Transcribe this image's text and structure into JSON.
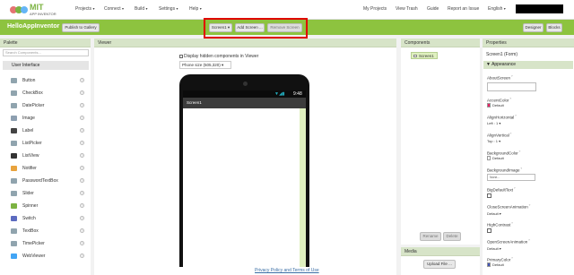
{
  "brand": {
    "mit": "MIT",
    "app_inventor": "APP INVENTOR"
  },
  "top_menu": [
    {
      "label": "Projects"
    },
    {
      "label": "Connect"
    },
    {
      "label": "Build"
    },
    {
      "label": "Settings"
    },
    {
      "label": "Help"
    }
  ],
  "top_links": {
    "my_projects": "My Projects",
    "view_trash": "View Trash",
    "guide": "Guide",
    "report_issue": "Report an Issue",
    "language": "English"
  },
  "project": {
    "name": "HelloAppInventor",
    "publish": "Publish to Gallery",
    "screen_select": "Screen1",
    "add_screen": "Add Screen ...",
    "remove_screen": "Remove Screen",
    "designer": "Designer",
    "blocks": "Blocks"
  },
  "palette": {
    "title": "Palette",
    "search_placeholder": "Search Components...",
    "section": "User Interface",
    "items": [
      {
        "label": "Button",
        "color": "#90a4ae"
      },
      {
        "label": "CheckBox",
        "color": "#90a4ae"
      },
      {
        "label": "DatePicker",
        "color": "#90a4ae"
      },
      {
        "label": "Image",
        "color": "#8d9fb0"
      },
      {
        "label": "Label",
        "color": "#444444"
      },
      {
        "label": "ListPicker",
        "color": "#90a4ae"
      },
      {
        "label": "ListView",
        "color": "#333333"
      },
      {
        "label": "Notifier",
        "color": "#e8a33d"
      },
      {
        "label": "PasswordTextBox",
        "color": "#90a4ae"
      },
      {
        "label": "Slider",
        "color": "#90a4ae"
      },
      {
        "label": "Spinner",
        "color": "#7cb342"
      },
      {
        "label": "Switch",
        "color": "#5c6bc0"
      },
      {
        "label": "TextBox",
        "color": "#90a4ae"
      },
      {
        "label": "TimePicker",
        "color": "#90a4ae"
      },
      {
        "label": "WebViewer",
        "color": "#42a5f5"
      }
    ]
  },
  "viewer": {
    "title": "Viewer",
    "hidden_checkbox": "Display hidden components in Viewer",
    "phone_size": "Phone size (505,320)",
    "clock": "9:48",
    "screen_title": "Screen1"
  },
  "components": {
    "title": "Components",
    "root": "Screen1",
    "rename": "Rename",
    "delete": "Delete"
  },
  "media": {
    "title": "Media",
    "upload": "Upload File ..."
  },
  "properties": {
    "title": "Properties",
    "subtitle": "Screen1 (Form)",
    "section": "Appearance",
    "about_screen": "AboutScreen",
    "accent_color": "AccentColor",
    "accent_value": "Default",
    "align_h": "AlignHorizontal",
    "align_h_value": "Left : 1",
    "align_v": "AlignVertical",
    "align_v_value": "Top : 1",
    "bg_color": "BackgroundColor",
    "bg_value": "Default",
    "bg_image": "BackgroundImage",
    "bg_image_value": "None...",
    "big_default": "BigDefaultText",
    "close_anim": "CloseScreenAnimation",
    "close_value": "Default",
    "high_contrast": "HighContrast",
    "open_anim": "OpenScreenAnimation",
    "open_value": "Default",
    "primary_color": "PrimaryColor",
    "primary_value": "Default",
    "accent_swatch": "#e91e63",
    "primary_swatch": "#3f51b5"
  },
  "footer": "Privacy Policy and Terms of Use",
  "colors": {
    "green_bar": "#8dc33f",
    "highlight": "#e00000"
  }
}
